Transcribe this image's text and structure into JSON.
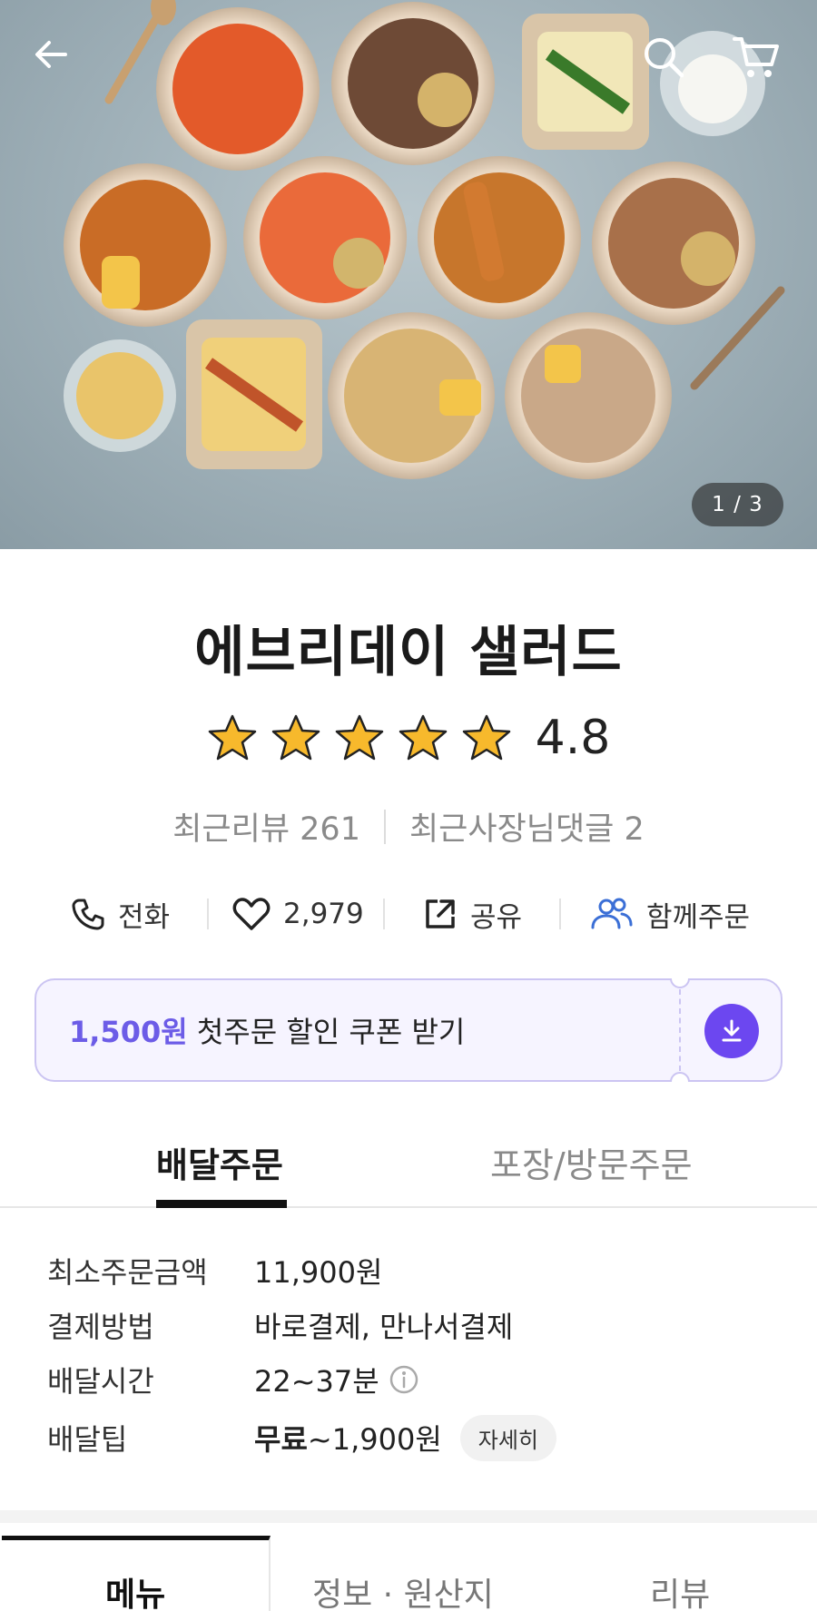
{
  "hero": {
    "image_counter": "1 / 3"
  },
  "store": {
    "name": "에브리데이 샐러드",
    "rating": "4.8",
    "star_count": 5
  },
  "reviews": {
    "recent_reviews": "최근리뷰 261",
    "owner_replies": "최근사장님댓글 2"
  },
  "actions": {
    "call": "전화",
    "likes": "2,979",
    "share": "공유",
    "group_order": "함께주문"
  },
  "coupon": {
    "amount": "1,500원",
    "text": "첫주문 할인 쿠폰 받기"
  },
  "order_tabs": {
    "delivery": "배달주문",
    "pickup": "포장/방문주문"
  },
  "info": {
    "min_order_label": "최소주문금액",
    "min_order_value": "11,900원",
    "payment_label": "결제방법",
    "payment_value": "바로결제, 만나서결제",
    "delivery_time_label": "배달시간",
    "delivery_time_value": "22~37분",
    "delivery_fee_label": "배달팁",
    "delivery_fee_free": "무료",
    "delivery_fee_range": "~1,900원",
    "detail_button": "자세히"
  },
  "bottom_tabs": {
    "menu": "메뉴",
    "info_origin": "정보 · 원산지",
    "review": "리뷰"
  },
  "colors": {
    "accent": "#6c5ce7",
    "coupon_bg": "#f6f4ff",
    "group_order_icon": "#3b6fd6",
    "star": "#f7b92c"
  }
}
